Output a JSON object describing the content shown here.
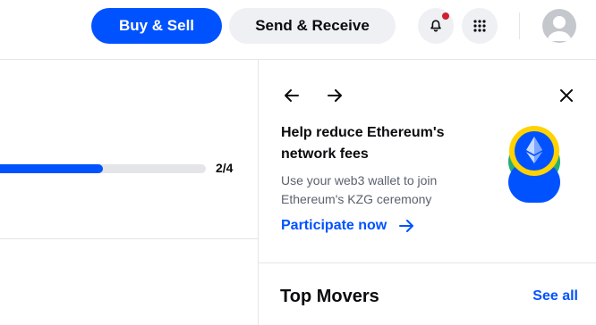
{
  "header": {
    "buy_sell_label": "Buy & Sell",
    "send_receive_label": "Send & Receive",
    "notification_icon": "bell-icon",
    "apps_icon": "grid-icon",
    "avatar_icon": "user-avatar-icon"
  },
  "progress": {
    "label": "2/4",
    "fraction": 0.5
  },
  "promo": {
    "title": "Help reduce Ethereum's network fees",
    "body": "Use your web3 wallet to join Ethereum's KZG ceremony",
    "cta_label": "Participate now",
    "icons": {
      "prev": "arrow-left-icon",
      "next": "arrow-right-icon",
      "close": "close-icon",
      "cta": "arrow-right-icon",
      "art": "ethereum-icon"
    }
  },
  "top_movers": {
    "title": "Top Movers",
    "see_all_label": "See all"
  },
  "colors": {
    "accent": "#0052ff",
    "notification": "#cf202f",
    "art_yellow": "#ffd200",
    "art_green": "#27ad75"
  }
}
